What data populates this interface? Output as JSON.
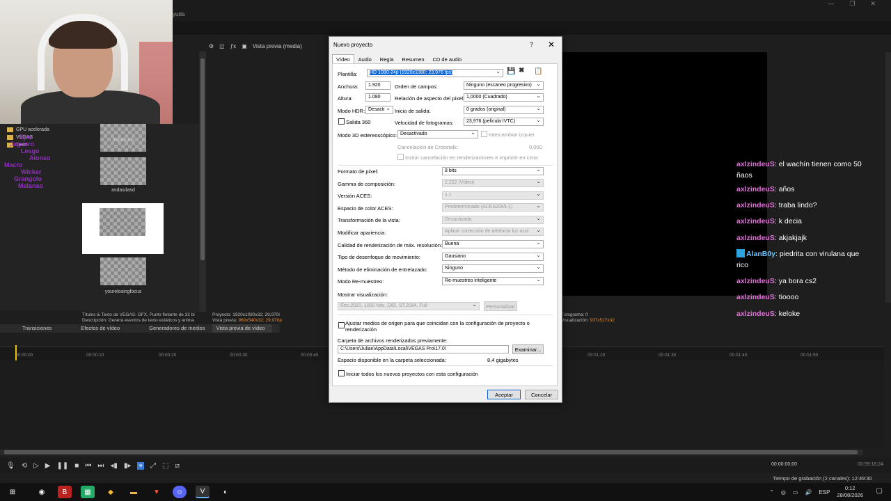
{
  "menu_fragment": "yuda",
  "explorer": {
    "items": [
      "GPU acelerada",
      "VEGAS",
      "Texto"
    ]
  },
  "neon_overlay": [
    "Ejes",
    "Jaguero",
    "Lesgo",
    "Alonso",
    "Macro",
    "Macaro_bolo",
    "Wicker",
    "Grangolo",
    "Malanao"
  ],
  "media": {
    "items": [
      "Subtítulos",
      "asdasdasd",
      "yourelosingfocus"
    ]
  },
  "preview_toolbar": {
    "label": "Vista previa (media)"
  },
  "info": {
    "left_line1": "Títulos & Texto de VEGAS: OFX, Punto flotante de 32 bi",
    "left_line2": "Descripción: Genera eventos de texto estáticos y anima",
    "project_label": "Proyecto:",
    "project_value": "1920x1080x32; 29,970i",
    "preview_label": "Vista previa:",
    "preview_value": "960x540x32; 29,970p",
    "display_label": "Visualización:",
    "display_value": "937x527x32",
    "frame_label": "Fotograma:",
    "frame_value": "0"
  },
  "tabs": [
    "Transiciones",
    "Efectos de vídeo",
    "Generadores de medios",
    "Vista previa de vídeo"
  ],
  "timeline": {
    "ticks": [
      "00:00:00",
      "00:00:10",
      "00:00:20",
      "00:00:30",
      "00:00:40",
      "00:01:20",
      "00:01:30",
      "00:01:40",
      "00:01:50"
    ],
    "cursor_time": "00:00:00;00",
    "total_time": "00:59:18;24",
    "rec_time": "Tiempo de grabación (2 canales): 12:49:30"
  },
  "chat": [
    {
      "user": "axlzindeuS",
      "text": "el wachín tienen como 50 ñaos"
    },
    {
      "user": "axlzindeuS",
      "text": "años"
    },
    {
      "user": "axlzindeuS",
      "text": "traba lindo?"
    },
    {
      "user": "axlzindeuS",
      "text": "k decia"
    },
    {
      "user": "axlzindeuS",
      "text": "akjakjajk"
    },
    {
      "user": "AlanB0y",
      "text": "piedrita con virulana que rico"
    },
    {
      "user": "axlzindeuS",
      "text": "ya bora cs2"
    },
    {
      "user": "axlzindeuS",
      "text": "tioooo"
    },
    {
      "user": "axlzindeuS",
      "text": "keloke"
    }
  ],
  "taskbar": {
    "lang": "ESP",
    "time": "0:12",
    "date": "28/08/2026"
  },
  "dialog": {
    "title": "Nuevo proyecto",
    "help": "?",
    "close": "✕",
    "tabs": [
      "Vídeo",
      "Audio",
      "Regla",
      "Resumen",
      "CD de audio"
    ],
    "plantilla_label": "Plantilla:",
    "plantilla_value": "HD 1080-24p (1920x1080; 23,976 fps)",
    "anchura_label": "Anchura:",
    "anchura_value": "1.920",
    "altura_label": "Altura:",
    "altura_value": "1.080",
    "hdr_label": "Modo HDR:",
    "hdr_value": "Desacti",
    "salida360_label": "Salida 360",
    "orden_label": "Orden de campos:",
    "orden_value": "Ninguno (escaneo progresivo)",
    "relacion_label": "Relación de aspecto del píxel:",
    "relacion_value": "1,0000 (Cuadrado)",
    "inicio_label": "Inicio de salida:",
    "inicio_value": "0 grados (original)",
    "velocidad_label": "Velocidad de fotogramas:",
    "velocidad_value": "23,976 (película IVTC)",
    "modo3d_label": "Modo 3D estereoscópico:",
    "modo3d_value": "Desactivado",
    "intercambiar_label": "Intercambiar izquier",
    "crosstalk_label": "Cancelación de Crosstalk:",
    "crosstalk_value": "0,000",
    "incluir_label": "Incluir cancelación en renderizaciones e imprimir en cinta",
    "formato_label": "Formato de píxel:",
    "formato_value": "8 bits",
    "gamma_label": "Gamma de composición:",
    "gamma_value": "2,222 (Vídeo)",
    "aces_label": "Versión ACES:",
    "aces_value": "1.1",
    "espacio_label": "Espacio de color ACES:",
    "espacio_value": "Predeterminado (ACES2065-1)",
    "transformacion_label": "Transformación de la vista:",
    "transformacion_value": "Desactivado",
    "apariencia_label": "Modificar apariencia:",
    "apariencia_value": "Aplicar corrección de artefacto luz azul",
    "calidad_label": "Calidad de renderización de máx. resolución:",
    "calidad_value": "Buena",
    "desenfoque_label": "Tipo de desenfoque de movimiento:",
    "desenfoque_value": "Gausiano",
    "entrelazado_label": "Método de eliminación de entrelazado:",
    "entrelazado_value": "Ninguno",
    "remuestreo_label": "Modo Re-muestreo:",
    "remuestreo_value": "Re-muestreo inteligente",
    "mostrar_label": "Mostrar visualización:",
    "mostrar_value": "Rec.2020, 1000 Nits, D65, ST.2084, Full",
    "personalizar_label": "Personalizar",
    "ajustar_label": "Ajustar medios de origen para que coincidan con la configuración de proyecto o renderización",
    "carpeta_label": "Carpeta de archivos renderizados previamente:",
    "carpeta_value": "C:\\Users\\Julian\\AppData\\Local\\VEGAS Pro\\17.0\\",
    "examinar_label": "Examinar...",
    "disponible_label": "Espacio disponible en la carpeta seleccionada:",
    "disponible_value": "8,4 gigabytes",
    "iniciar_label": "Iniciar todos los nuevos proyectos con esta configuración",
    "aceptar_label": "Aceptar",
    "cancelar_label": "Cancelar"
  }
}
